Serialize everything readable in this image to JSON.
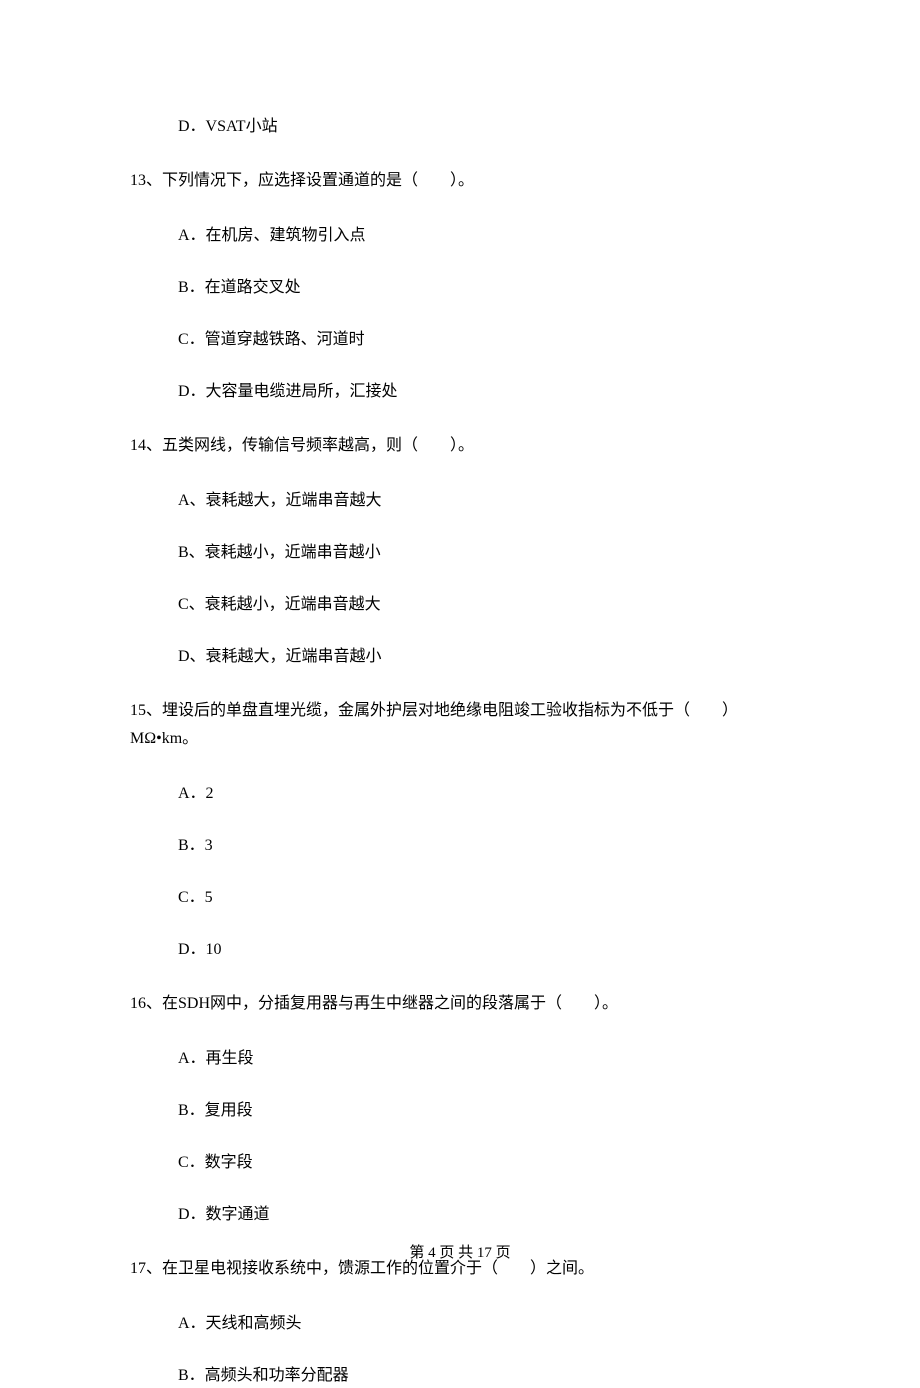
{
  "orphan_option": "D．VSAT小站",
  "questions": [
    {
      "text": "13、下列情况下，应选择设置通道的是（　　）。",
      "options": [
        "A．在机房、建筑物引入点",
        "B．在道路交叉处",
        "C．管道穿越铁路、河道时",
        "D．大容量电缆进局所，汇接处"
      ]
    },
    {
      "text": "14、五类网线，传输信号频率越高，则（　　）。",
      "options": [
        "A、衰耗越大，近端串音越大",
        "B、衰耗越小，近端串音越小",
        "C、衰耗越小，近端串音越大",
        "D、衰耗越大，近端串音越小"
      ]
    },
    {
      "text": "15、埋设后的单盘直埋光缆，金属外护层对地绝缘电阻竣工验收指标为不低于（　　）MΩ•km。",
      "options": [
        "A．2",
        "B．3",
        "C．5",
        "D．10"
      ]
    },
    {
      "text": "16、在SDH网中，分插复用器与再生中继器之间的段落属于（　　）。",
      "options": [
        "A．再生段",
        "B．复用段",
        "C．数字段",
        "D．数字通道"
      ]
    },
    {
      "text": "17、在卫星电视接收系统中，馈源工作的位置介于（　　）之间。",
      "options": [
        "A．天线和高频头",
        "B．高频头和功率分配器"
      ]
    }
  ],
  "footer": "第 4 页 共 17 页"
}
